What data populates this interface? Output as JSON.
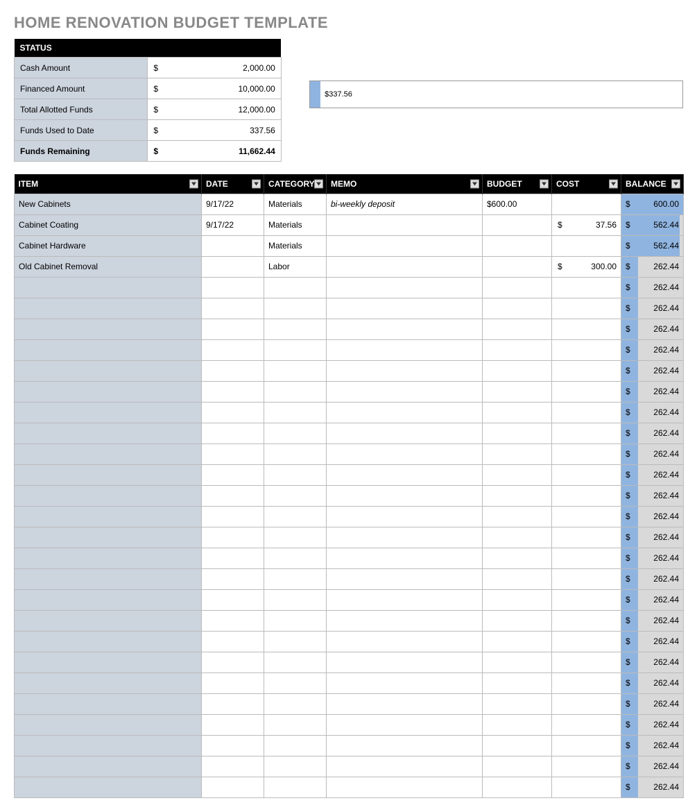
{
  "title": "HOME RENOVATION BUDGET TEMPLATE",
  "status": {
    "header": "STATUS",
    "rows": [
      {
        "label": "Cash Amount",
        "currency": "$",
        "value": "2,000.00",
        "bold": false
      },
      {
        "label": "Financed Amount",
        "currency": "$",
        "value": "10,000.00",
        "bold": false
      },
      {
        "label": "Total Allotted Funds",
        "currency": "$",
        "value": "12,000.00",
        "bold": false
      },
      {
        "label": "Funds Used to Date",
        "currency": "$",
        "value": "337.56",
        "bold": false
      },
      {
        "label": "Funds Remaining",
        "currency": "$",
        "value": "11,662.44",
        "bold": true
      }
    ]
  },
  "chart_data": {
    "type": "bar",
    "categories": [
      "Funds Used to Date"
    ],
    "values": [
      337.56
    ],
    "title": "",
    "xlabel": "",
    "ylabel": "",
    "ylim": [
      0,
      12000
    ],
    "label": "$337.56"
  },
  "grid": {
    "headers": {
      "item": "ITEM",
      "date": "DATE",
      "category": "CATEGORY",
      "memo": "MEMO",
      "budget": "BUDGET",
      "cost": "COST",
      "balance": "BALANCE"
    },
    "rows": [
      {
        "item": "New Cabinets",
        "date": "9/17/22",
        "category": "Materials",
        "memo": "bi-weekly deposit",
        "budget": "$600.00",
        "cost_sym": "",
        "cost": "",
        "balance": "600.00",
        "fill": 100
      },
      {
        "item": "Cabinet Coating",
        "date": "9/17/22",
        "category": "Materials",
        "memo": "",
        "budget": "",
        "cost_sym": "$",
        "cost": "37.56",
        "balance": "562.44",
        "fill": 94
      },
      {
        "item": "Cabinet Hardware",
        "date": "",
        "category": "Materials",
        "memo": "",
        "budget": "",
        "cost_sym": "",
        "cost": "",
        "balance": "562.44",
        "fill": 94
      },
      {
        "item": "Old Cabinet Removal",
        "date": "",
        "category": "Labor",
        "memo": "",
        "budget": "",
        "cost_sym": "$",
        "cost": "300.00",
        "balance": "262.44",
        "fill": 28
      },
      {
        "item": "",
        "date": "",
        "category": "",
        "memo": "",
        "budget": "",
        "cost_sym": "",
        "cost": "",
        "balance": "262.44",
        "fill": 28
      },
      {
        "item": "",
        "date": "",
        "category": "",
        "memo": "",
        "budget": "",
        "cost_sym": "",
        "cost": "",
        "balance": "262.44",
        "fill": 28
      },
      {
        "item": "",
        "date": "",
        "category": "",
        "memo": "",
        "budget": "",
        "cost_sym": "",
        "cost": "",
        "balance": "262.44",
        "fill": 28
      },
      {
        "item": "",
        "date": "",
        "category": "",
        "memo": "",
        "budget": "",
        "cost_sym": "",
        "cost": "",
        "balance": "262.44",
        "fill": 28
      },
      {
        "item": "",
        "date": "",
        "category": "",
        "memo": "",
        "budget": "",
        "cost_sym": "",
        "cost": "",
        "balance": "262.44",
        "fill": 28
      },
      {
        "item": "",
        "date": "",
        "category": "",
        "memo": "",
        "budget": "",
        "cost_sym": "",
        "cost": "",
        "balance": "262.44",
        "fill": 28
      },
      {
        "item": "",
        "date": "",
        "category": "",
        "memo": "",
        "budget": "",
        "cost_sym": "",
        "cost": "",
        "balance": "262.44",
        "fill": 28
      },
      {
        "item": "",
        "date": "",
        "category": "",
        "memo": "",
        "budget": "",
        "cost_sym": "",
        "cost": "",
        "balance": "262.44",
        "fill": 28
      },
      {
        "item": "",
        "date": "",
        "category": "",
        "memo": "",
        "budget": "",
        "cost_sym": "",
        "cost": "",
        "balance": "262.44",
        "fill": 28
      },
      {
        "item": "",
        "date": "",
        "category": "",
        "memo": "",
        "budget": "",
        "cost_sym": "",
        "cost": "",
        "balance": "262.44",
        "fill": 28
      },
      {
        "item": "",
        "date": "",
        "category": "",
        "memo": "",
        "budget": "",
        "cost_sym": "",
        "cost": "",
        "balance": "262.44",
        "fill": 28
      },
      {
        "item": "",
        "date": "",
        "category": "",
        "memo": "",
        "budget": "",
        "cost_sym": "",
        "cost": "",
        "balance": "262.44",
        "fill": 28
      },
      {
        "item": "",
        "date": "",
        "category": "",
        "memo": "",
        "budget": "",
        "cost_sym": "",
        "cost": "",
        "balance": "262.44",
        "fill": 28
      },
      {
        "item": "",
        "date": "",
        "category": "",
        "memo": "",
        "budget": "",
        "cost_sym": "",
        "cost": "",
        "balance": "262.44",
        "fill": 28
      },
      {
        "item": "",
        "date": "",
        "category": "",
        "memo": "",
        "budget": "",
        "cost_sym": "",
        "cost": "",
        "balance": "262.44",
        "fill": 28
      },
      {
        "item": "",
        "date": "",
        "category": "",
        "memo": "",
        "budget": "",
        "cost_sym": "",
        "cost": "",
        "balance": "262.44",
        "fill": 28
      },
      {
        "item": "",
        "date": "",
        "category": "",
        "memo": "",
        "budget": "",
        "cost_sym": "",
        "cost": "",
        "balance": "262.44",
        "fill": 28
      },
      {
        "item": "",
        "date": "",
        "category": "",
        "memo": "",
        "budget": "",
        "cost_sym": "",
        "cost": "",
        "balance": "262.44",
        "fill": 28
      },
      {
        "item": "",
        "date": "",
        "category": "",
        "memo": "",
        "budget": "",
        "cost_sym": "",
        "cost": "",
        "balance": "262.44",
        "fill": 28
      },
      {
        "item": "",
        "date": "",
        "category": "",
        "memo": "",
        "budget": "",
        "cost_sym": "",
        "cost": "",
        "balance": "262.44",
        "fill": 28
      },
      {
        "item": "",
        "date": "",
        "category": "",
        "memo": "",
        "budget": "",
        "cost_sym": "",
        "cost": "",
        "balance": "262.44",
        "fill": 28
      },
      {
        "item": "",
        "date": "",
        "category": "",
        "memo": "",
        "budget": "",
        "cost_sym": "",
        "cost": "",
        "balance": "262.44",
        "fill": 28
      },
      {
        "item": "",
        "date": "",
        "category": "",
        "memo": "",
        "budget": "",
        "cost_sym": "",
        "cost": "",
        "balance": "262.44",
        "fill": 28
      },
      {
        "item": "",
        "date": "",
        "category": "",
        "memo": "",
        "budget": "",
        "cost_sym": "",
        "cost": "",
        "balance": "262.44",
        "fill": 28
      },
      {
        "item": "",
        "date": "",
        "category": "",
        "memo": "",
        "budget": "",
        "cost_sym": "",
        "cost": "",
        "balance": "262.44",
        "fill": 28
      }
    ]
  },
  "dollar_sym": "$"
}
